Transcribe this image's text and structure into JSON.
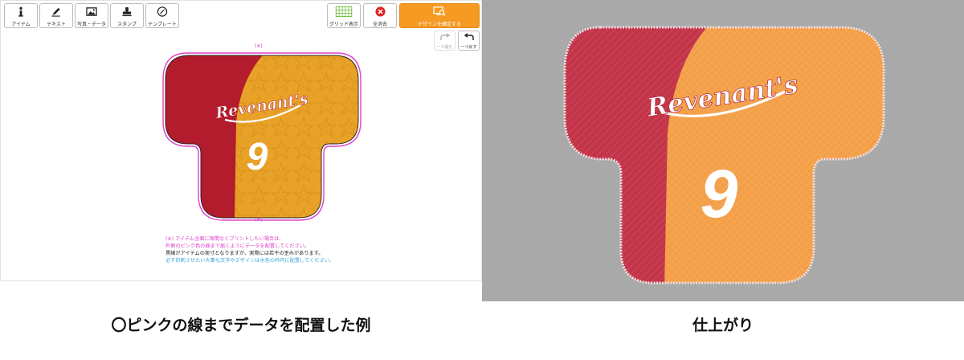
{
  "toolbar": {
    "item_label": "アイテム",
    "text_label": "テキスト",
    "photo_label": "写真・データ",
    "stamp_label": "スタンプ",
    "template_label": "テンプレート"
  },
  "actions": {
    "grid_label": "グリッド表示",
    "clear_label": "全消去",
    "confirm_label": "デザインを確定する"
  },
  "history": {
    "redo_label": "一つ進む",
    "undo_label": "一つ戻す"
  },
  "canvas": {
    "top_mark": "(※)",
    "bottom_mark": "(※)",
    "logo_text": "Revenant's",
    "number_text": "9"
  },
  "notes": {
    "line1": "(※) アイテム全面に隙間なくプリントしたい場合は、",
    "line2": "外側のピンク色の線まで届くようにデータを配置してください。",
    "line3": "黒線がアイテムの実寸となりますが、実際には若干の歪みがあります。",
    "line4": "必ず印刷させたい大事な文字やデザインは水色の枠内に配置してください。"
  },
  "captions": {
    "left": "〇ピンクの線までデータを配置した例",
    "right": "仕上がり"
  },
  "colors": {
    "red": "#b21c2c",
    "orange": "#e9a228",
    "photo_red": "#c4354a",
    "photo_orange": "#f4a14a",
    "accent_orange": "#f59a23",
    "pink_guide": "#e040c8"
  }
}
